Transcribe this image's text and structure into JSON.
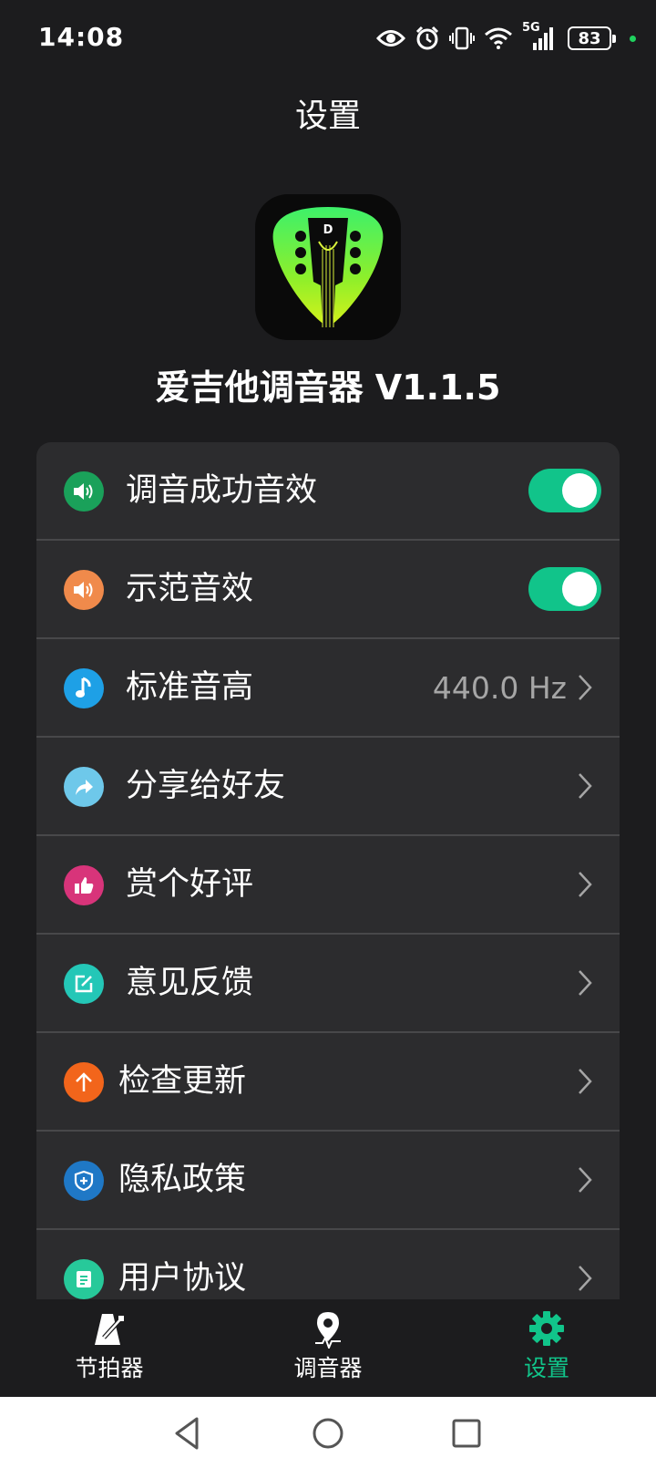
{
  "status_bar": {
    "time": "14:08",
    "network": "5G",
    "battery": "83",
    "icons": [
      "eye-icon",
      "alarm-icon",
      "vibrate-icon",
      "wifi-icon",
      "signal-icon",
      "battery-icon"
    ]
  },
  "header": {
    "title": "设置"
  },
  "app": {
    "name": "爱吉他调音器 V1.1.5",
    "logo_icon": "guitar-pick-headstock-logo"
  },
  "settings": [
    {
      "id": "tune-success-sound",
      "label": "调音成功音效",
      "icon": "speaker-icon",
      "icon_color": "#1aa15a",
      "control": "toggle",
      "on": true
    },
    {
      "id": "demo-sound",
      "label": "示范音效",
      "icon": "speaker-icon",
      "icon_color": "#f08a4b",
      "control": "toggle",
      "on": true
    },
    {
      "id": "standard-pitch",
      "label": "标准音高",
      "icon": "music-note-icon",
      "icon_color": "#1ea0e6",
      "control": "value",
      "value": "440.0 Hz"
    },
    {
      "id": "share",
      "label": "分享给好友",
      "icon": "share-arrow-icon",
      "icon_color": "#6ec8ea",
      "control": "chevron"
    },
    {
      "id": "rate",
      "label": "赏个好评",
      "icon": "thumbs-up-icon",
      "icon_color": "#d8347a",
      "control": "chevron"
    },
    {
      "id": "feedback",
      "label": "意见反馈",
      "icon": "edit-icon",
      "icon_color": "#24c7b7",
      "control": "chevron"
    },
    {
      "id": "update",
      "label": "检查更新",
      "icon": "arrow-up-icon",
      "icon_color": "#f2651b",
      "control": "chevron"
    },
    {
      "id": "privacy",
      "label": "隐私政策",
      "icon": "shield-plus-icon",
      "icon_color": "#1f78c6",
      "control": "chevron"
    },
    {
      "id": "agreement",
      "label": "用户协议",
      "icon": "document-icon",
      "icon_color": "#27c99a",
      "control": "chevron"
    }
  ],
  "tabs": [
    {
      "label": "节拍器",
      "icon": "metronome-icon",
      "active": false
    },
    {
      "label": "调音器",
      "icon": "tuner-pin-icon",
      "active": false
    },
    {
      "label": "设置",
      "icon": "gear-icon",
      "active": true
    }
  ],
  "colors": {
    "accent": "#11c48a",
    "background": "#1c1c1e",
    "card": "#2c2c2e"
  }
}
